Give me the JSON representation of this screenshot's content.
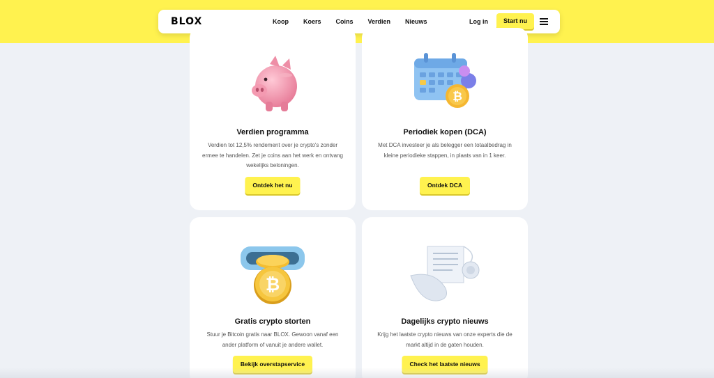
{
  "header": {
    "logo": "BLOX",
    "nav": [
      "Koop",
      "Koers",
      "Coins",
      "Verdien",
      "Nieuws"
    ],
    "login": "Log in",
    "start": "Start nu",
    "menu_icon": "hamburger-icon"
  },
  "colors": {
    "brand_yellow": "#fff24f",
    "page_background": "#eef1f6",
    "card_background": "#ffffff"
  },
  "cards": [
    {
      "icon": "piggy-bank-icon",
      "title": "Verdien programma",
      "description": "Verdien tot 12,5% rendement over je crypto's zonder ermee te handelen. Zet je coins aan het werk en ontvang wekelijks beloningen.",
      "button": "Ontdek het nu"
    },
    {
      "icon": "calendar-bitcoin-icon",
      "title": "Periodiek kopen (DCA)",
      "description": "Met DCA investeer je als belegger een totaalbedrag in kleine periodieke stappen, in plaats van in 1 keer.",
      "button": "Ontdek DCA"
    },
    {
      "icon": "bitcoin-deposit-icon",
      "title": "Gratis crypto storten",
      "description": "Stuur je Bitcoin gratis naar BLOX. Gewoon vanaf een ander platform of vanuit je andere wallet.",
      "button": "Bekijk overstapservice"
    },
    {
      "icon": "news-scroll-icon",
      "title": "Dagelijks crypto nieuws",
      "description": "Krijg het laatste crypto nieuws van onze experts die de markt altijd in de gaten houden.",
      "button": "Check het laatste nieuws"
    }
  ]
}
